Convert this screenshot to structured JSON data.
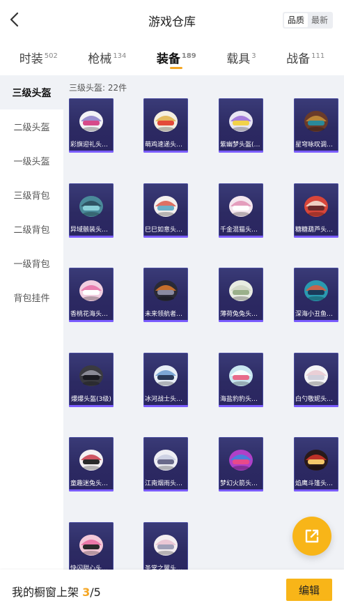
{
  "header": {
    "title": "游戏仓库",
    "sort_options": [
      "品质",
      "最新"
    ],
    "sort_active": 0
  },
  "tabs": [
    {
      "label": "时装",
      "count": "502"
    },
    {
      "label": "枪械",
      "count": "134"
    },
    {
      "label": "装备",
      "count": "189",
      "active": true
    },
    {
      "label": "载具",
      "count": "3"
    },
    {
      "label": "战备",
      "count": "111"
    }
  ],
  "sidebar": {
    "items": [
      "三级头盔",
      "二级头盔",
      "一级头盔",
      "三级背包",
      "二级背包",
      "一级背包",
      "背包挂件"
    ],
    "active_index": 0
  },
  "content": {
    "count_label": "三级头盔: 22件",
    "items": [
      {
        "name": "彩旗迎礼头盔...",
        "colors": [
          "#f3f3f6",
          "#8a7cc8",
          "#d64a8a"
        ]
      },
      {
        "name": "萌鸡速递头盔...",
        "colors": [
          "#f4efe0",
          "#e0b34a",
          "#e34a3a"
        ]
      },
      {
        "name": "紫幽梦头盔(3...",
        "colors": [
          "#e8e6f3",
          "#9a6ad6",
          "#f2d24a"
        ]
      },
      {
        "name": "星穹咏叹调头...",
        "colors": [
          "#6a3b2a",
          "#c8933a",
          "#2a8a9a"
        ]
      },
      {
        "name": "异域骸装头盔...",
        "colors": [
          "#4a8a9a",
          "#2a4a5a",
          "#8ad0d8"
        ]
      },
      {
        "name": "巳巳如意头盔...",
        "colors": [
          "#f4f0ee",
          "#d85a4a",
          "#6ab0c8"
        ]
      },
      {
        "name": "千金混猫头盔...",
        "colors": [
          "#f4e6ee",
          "#e090b4",
          "#ffffff"
        ]
      },
      {
        "name": "糖糖葫芦头盔...",
        "colors": [
          "#d8463a",
          "#f3e6d8",
          "#6a2a2a"
        ]
      },
      {
        "name": "香桃花海头盔...",
        "colors": [
          "#f2cfe0",
          "#e870a6",
          "#ffffff"
        ]
      },
      {
        "name": "未来领航者头...",
        "colors": [
          "#2a2a36",
          "#e07a2a",
          "#8a8aa0"
        ]
      },
      {
        "name": "薄荷兔兔头盔...",
        "colors": [
          "#e8ece2",
          "#cfd6c4",
          "#9ab08a"
        ]
      },
      {
        "name": "深海小丑鱼头...",
        "colors": [
          "#2a9ab0",
          "#e05a3a",
          "#1a3a5a"
        ]
      },
      {
        "name": "爆爆头盔(3级)",
        "colors": [
          "#3a3a40",
          "#9a9aa6",
          "#1a1a20"
        ]
      },
      {
        "name": "冰河战士头盔...",
        "colors": [
          "#e8eef6",
          "#6a9ad0",
          "#2a3a5a"
        ]
      },
      {
        "name": "海盐豹豹头盔...",
        "colors": [
          "#c8e6f0",
          "#ffffff",
          "#e86a8a"
        ]
      },
      {
        "name": "白勺敬妮头盔...",
        "colors": [
          "#f4f4f6",
          "#e8c8d0",
          "#d0d0dc"
        ]
      },
      {
        "name": "童趣迷兔头盔...",
        "colors": [
          "#f4f0f2",
          "#c83a4a",
          "#2a2a2a"
        ]
      },
      {
        "name": "江南烟雨头盔...",
        "colors": [
          "#eeeef4",
          "#c8cce0",
          "#6a6a8a"
        ]
      },
      {
        "name": "梦幻火箭头盔...",
        "colors": [
          "#b040c8",
          "#3a8ae0",
          "#e84a8a"
        ]
      },
      {
        "name": "焰鹰斗篷头盔...",
        "colors": [
          "#2a1a1a",
          "#d8362a",
          "#f4c86a"
        ]
      },
      {
        "name": "快闪甜心头盔...",
        "colors": [
          "#f4c8d8",
          "#e86aa0",
          "#2a2a2a"
        ]
      },
      {
        "name": "圣堂之翼头盔...",
        "colors": [
          "#f4eef0",
          "#e8c0d0",
          "#a0a0b8"
        ]
      }
    ]
  },
  "floating": {
    "icon": "share-icon"
  },
  "footer": {
    "shelf_label": "我的橱窗上架",
    "shelf_current": "3",
    "shelf_total": "/5",
    "edit_label": "编辑"
  }
}
